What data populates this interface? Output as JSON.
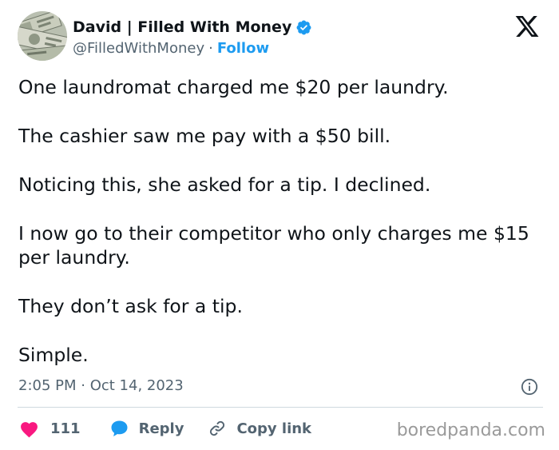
{
  "author": {
    "display_name": "David | Filled With Money",
    "handle": "@FilledWithMoney",
    "separator": "·",
    "follow_label": "Follow",
    "verified_color": "#1d9bf0"
  },
  "tweet": {
    "paragraphs": [
      "One laundromat charged me $20 per laundry.",
      "The cashier saw me pay with a $50 bill.",
      "Noticing this, she asked for a tip. I declined.",
      "I now go to their competitor who only charges me $15 per laundry.",
      "They don’t ask for a tip.",
      "Simple."
    ],
    "timestamp": "2:05 PM · Oct 14, 2023"
  },
  "actions": {
    "like_count": "111",
    "reply_label": "Reply",
    "copy_link_label": "Copy link",
    "like_color": "#f91880",
    "reply_color": "#1d9bf0"
  },
  "icons": {
    "platform": "x-logo-icon",
    "info": "info-icon",
    "like": "heart-icon",
    "reply": "speech-bubble-icon",
    "copy": "link-icon"
  },
  "watermark": "boredpanda.com"
}
